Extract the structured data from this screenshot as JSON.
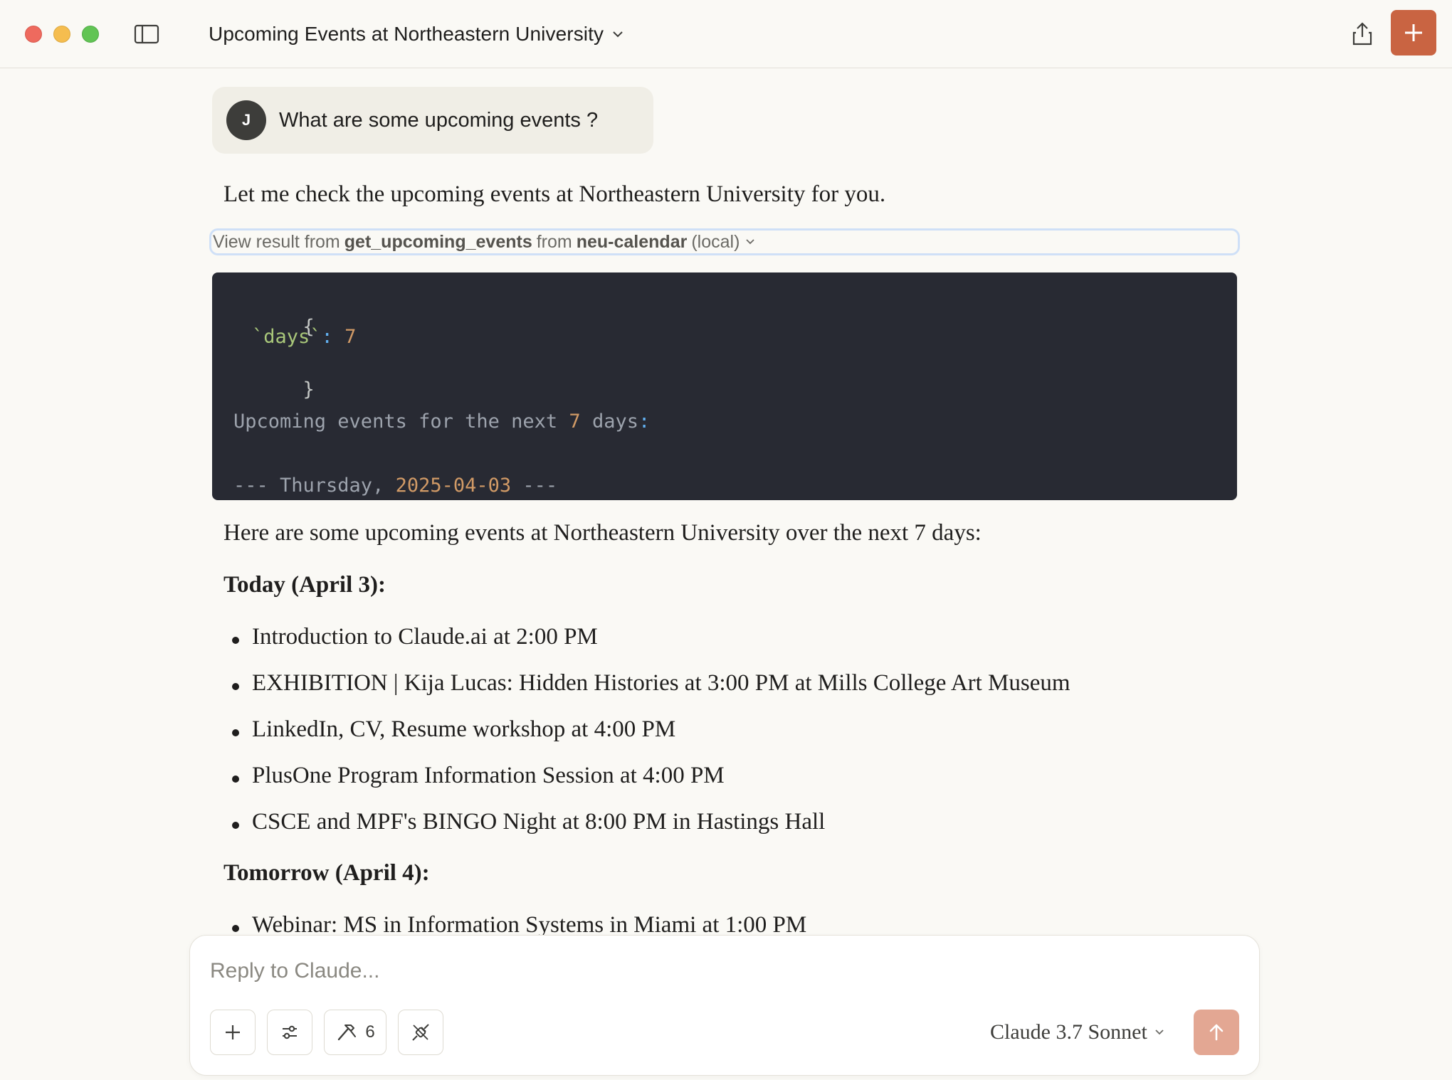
{
  "window": {
    "title": "Upcoming Events at Northeastern University"
  },
  "conversation": {
    "user": {
      "avatar_initial": "J",
      "message": "What are some upcoming events ?"
    },
    "assistant_intro": "Let me check the upcoming events at Northeastern University for you.",
    "tool_result": {
      "prefix": "View result from",
      "tool_name": "get_upcoming_events",
      "from_word": "from",
      "server_name": "neu-calendar",
      "suffix": "(local)"
    },
    "code": {
      "open_brace": "{",
      "key": "`days`",
      "colon": ":",
      "value": "7",
      "close_brace": "}",
      "line_head": "Upcoming events for the next",
      "line_num": "7",
      "line_tail": "days",
      "line_colon": ":",
      "date_prefix": "--- Thursday,",
      "date_value": "2025-04-03",
      "date_suffix": "---"
    },
    "summary": "Here are some upcoming events at Northeastern University over the next 7 days:",
    "sections": [
      {
        "heading": "Today (April 3):",
        "items": [
          "Introduction to Claude.ai at 2:00 PM",
          "EXHIBITION | Kija Lucas: Hidden Histories at 3:00 PM at Mills College Art Museum",
          "LinkedIn, CV, Resume workshop at 4:00 PM",
          "PlusOne Program Information Session at 4:00 PM",
          "CSCE and MPF's BINGO Night at 8:00 PM in Hastings Hall"
        ]
      },
      {
        "heading": "Tomorrow (April 4):",
        "items": [
          "Webinar: MS in Information Systems in Miami at 1:00 PM"
        ]
      }
    ]
  },
  "composer": {
    "placeholder": "Reply to Claude...",
    "tools_count": "6",
    "model": "Claude 3.7 Sonnet"
  },
  "colors": {
    "accent": "#c96442",
    "send_disabled": "#e3a793",
    "code_bg": "#282a33"
  }
}
